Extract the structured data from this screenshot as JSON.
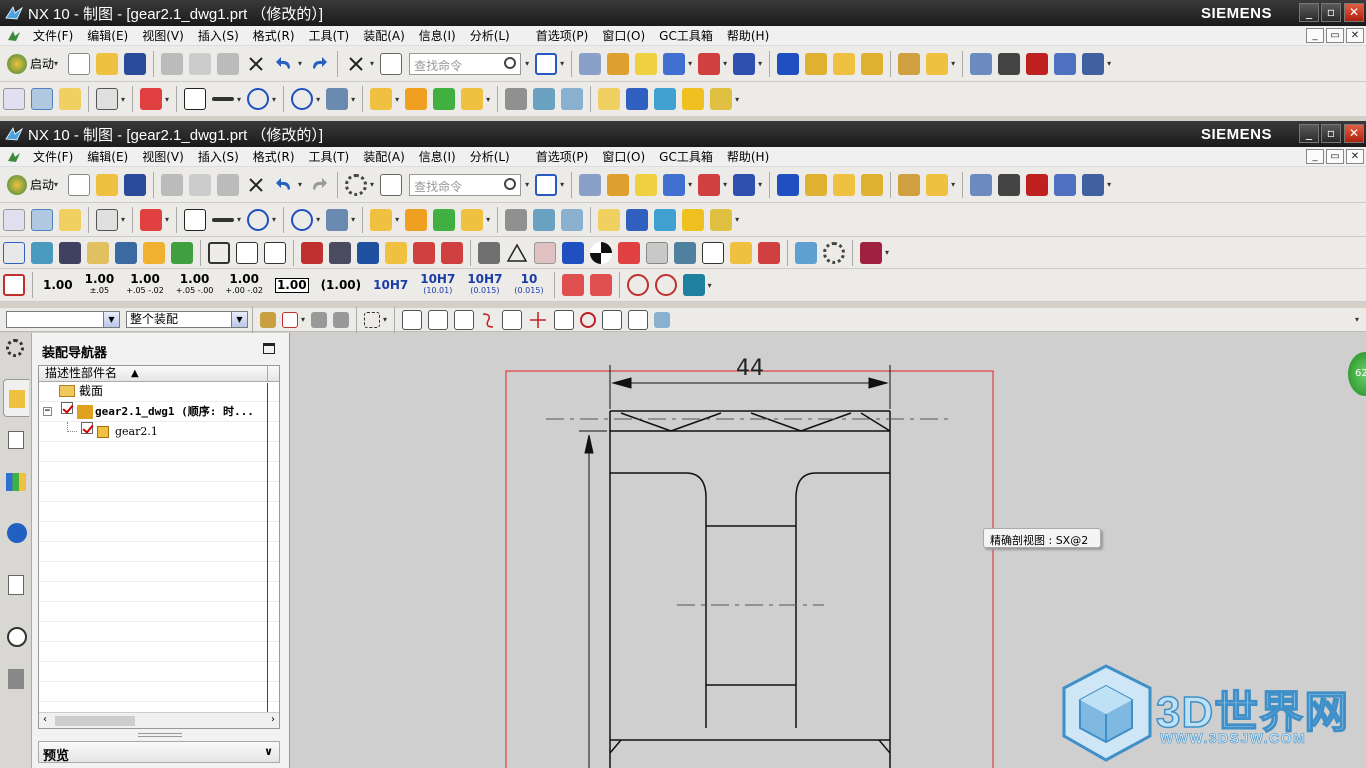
{
  "window_back": {
    "title": "NX 10 - 制图 - [gear2.1_dwg1.prt （修改的）]",
    "brand": "SIEMENS"
  },
  "window_front": {
    "title": "NX 10 - 制图 - [gear2.1_dwg1.prt （修改的）]",
    "brand": "SIEMENS"
  },
  "menu": [
    "文件(F)",
    "编辑(E)",
    "视图(V)",
    "插入(S)",
    "格式(R)",
    "工具(T)",
    "装配(A)",
    "信息(I)",
    "分析(L)",
    "首选项(P)",
    "窗口(O)",
    "GC工具箱",
    "帮助(H)"
  ],
  "toolbar": {
    "start_label": "启动",
    "search_placeholder": "查找命令"
  },
  "dimension_toolbar": {
    "values": [
      {
        "main": "1.00",
        "sub": ""
      },
      {
        "main": "1.00",
        "sub": "±.05"
      },
      {
        "main": "1.00",
        "sub": "+.05 -.02"
      },
      {
        "main": "1.00",
        "sub": "+.05 -.00"
      },
      {
        "main": "1.00",
        "sub": "+.00 -.02"
      },
      {
        "main": "1.00",
        "sub": ""
      },
      {
        "main": "(1.00)",
        "sub": ""
      },
      {
        "main": "10H7",
        "sub": ""
      },
      {
        "main": "10H7",
        "sub": "(10.01)"
      },
      {
        "main": "10H7",
        "sub": "(0.015)"
      },
      {
        "main": "10",
        "sub": "(0.015)"
      }
    ]
  },
  "selection_bar": {
    "filter_value": "",
    "scope_value": "整个装配"
  },
  "navigator": {
    "title": "装配导航器",
    "column_header": "描述性部件名",
    "rows": [
      {
        "label": "截面"
      },
      {
        "label": "gear2.1_dwg1 (顺序: 时..."
      },
      {
        "label": "gear2.1"
      }
    ],
    "preview_label": "预览"
  },
  "canvas": {
    "dimension_label": "44",
    "tooltip": "精确剖视图 : SX@2",
    "badge": "62"
  },
  "watermark": {
    "text": "3D世界网",
    "url": "WWW.3DSJW.COM"
  },
  "colors": {
    "title_bar": "#1a1a1a",
    "canvas_bg": "#cfcfcf",
    "drawing_border": "#e02020",
    "watermark_blue": "#3f8fc8"
  }
}
